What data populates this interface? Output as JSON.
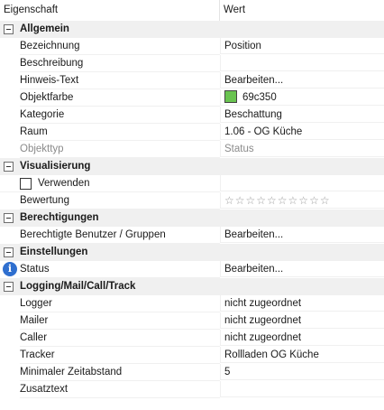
{
  "header": {
    "col_property": "Eigenschaft",
    "col_value": "Wert"
  },
  "allgemein": {
    "title": "Allgemein",
    "bezeichnung": {
      "label": "Bezeichnung",
      "value": "Position"
    },
    "beschreibung": {
      "label": "Beschreibung",
      "value": ""
    },
    "hinweis": {
      "label": "Hinweis-Text",
      "value": "Bearbeiten..."
    },
    "objektfarbe": {
      "label": "Objektfarbe",
      "value": "69c350",
      "color": "#69c350"
    },
    "kategorie": {
      "label": "Kategorie",
      "value": "Beschattung"
    },
    "raum": {
      "label": "Raum",
      "value": "1.06 - OG Küche"
    },
    "objekttyp": {
      "label": "Objekttyp",
      "value": "Status"
    }
  },
  "visualisierung": {
    "title": "Visualisierung",
    "verwenden": {
      "label": "Verwenden",
      "checked": false
    },
    "bewertung": {
      "label": "Bewertung",
      "stars": "☆☆☆☆☆☆☆☆☆☆",
      "rating": 0,
      "max": 10
    }
  },
  "berechtigungen": {
    "title": "Berechtigungen",
    "benutzer": {
      "label": "Berechtigte Benutzer / Gruppen",
      "value": "Bearbeiten..."
    }
  },
  "einstellungen": {
    "title": "Einstellungen",
    "status": {
      "label": "Status",
      "value": "Bearbeiten...",
      "icon": "info-icon",
      "icon_glyph": "i"
    }
  },
  "logging": {
    "title": "Logging/Mail/Call/Track",
    "logger": {
      "label": "Logger",
      "value": "nicht zugeordnet"
    },
    "mailer": {
      "label": "Mailer",
      "value": "nicht zugeordnet"
    },
    "caller": {
      "label": "Caller",
      "value": "nicht zugeordnet"
    },
    "tracker": {
      "label": "Tracker",
      "value": "Rollladen OG Küche"
    },
    "zeitabstand": {
      "label": "Minimaler Zeitabstand",
      "value": "5"
    },
    "zusatztext": {
      "label": "Zusatztext",
      "value": ""
    }
  }
}
